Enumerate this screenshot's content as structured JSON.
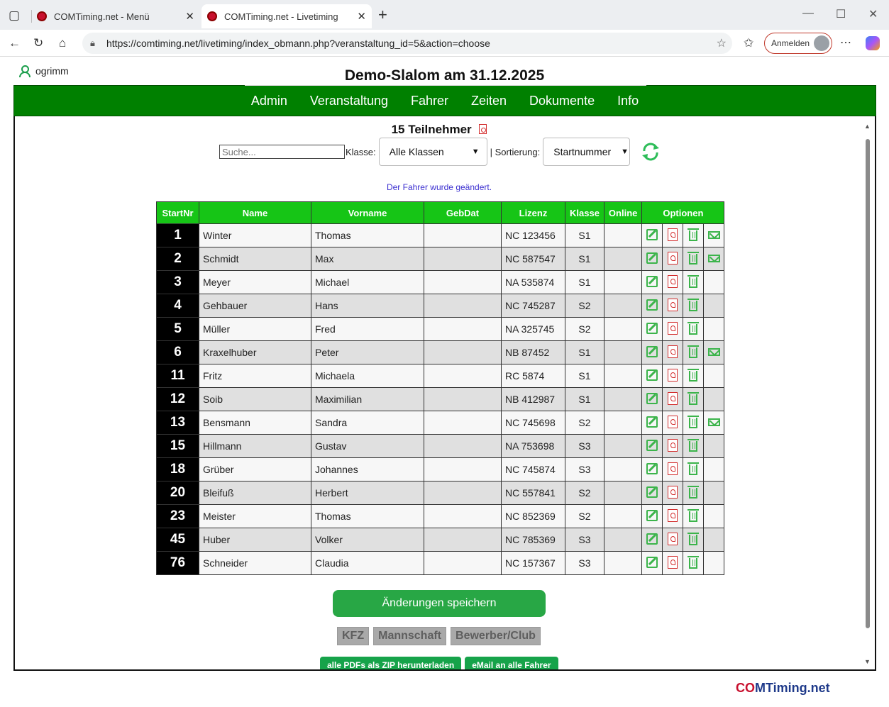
{
  "browser": {
    "tab1_title": "COMTiming.net - Menü",
    "tab2_title": "COMTiming.net - Livetiming",
    "url": "https://comtiming.net/livetiming/index_obmann.php?veranstaltung_id=5&action=choose",
    "signin_label": "Anmelden"
  },
  "user": {
    "name": "ogrimm"
  },
  "event": {
    "title": "Demo-Slalom am 31.12.2025"
  },
  "nav": {
    "items": [
      "Admin",
      "Veranstaltung",
      "Fahrer",
      "Zeiten",
      "Dokumente",
      "Info"
    ]
  },
  "participants": {
    "count_label": "15 Teilnehmer"
  },
  "filters": {
    "search_placeholder": "Suche...",
    "class_label": "Klasse:",
    "class_value": "Alle Klassen",
    "sort_label": "| Sortierung:",
    "sort_value": "Startnummer"
  },
  "message": "Der Fahrer wurde geändert.",
  "table": {
    "headers": [
      "StartNr",
      "Name",
      "Vorname",
      "GebDat",
      "Lizenz",
      "Klasse",
      "Online",
      "Optionen"
    ],
    "rows": [
      {
        "nr": "1",
        "name": "Winter",
        "vorname": "Thomas",
        "gebdat": "",
        "lizenz": "NC 123456",
        "klasse": "S1",
        "online": "",
        "mail": true
      },
      {
        "nr": "2",
        "name": "Schmidt",
        "vorname": "Max",
        "gebdat": "",
        "lizenz": "NC 587547",
        "klasse": "S1",
        "online": "",
        "mail": true
      },
      {
        "nr": "3",
        "name": "Meyer",
        "vorname": "Michael",
        "gebdat": "",
        "lizenz": "NA 535874",
        "klasse": "S1",
        "online": "",
        "mail": false
      },
      {
        "nr": "4",
        "name": "Gehbauer",
        "vorname": "Hans",
        "gebdat": "",
        "lizenz": "NC 745287",
        "klasse": "S2",
        "online": "",
        "mail": false
      },
      {
        "nr": "5",
        "name": "Müller",
        "vorname": "Fred",
        "gebdat": "",
        "lizenz": "NA 325745",
        "klasse": "S2",
        "online": "",
        "mail": false
      },
      {
        "nr": "6",
        "name": "Kraxelhuber",
        "vorname": "Peter",
        "gebdat": "",
        "lizenz": "NB 87452",
        "klasse": "S1",
        "online": "",
        "mail": true
      },
      {
        "nr": "11",
        "name": "Fritz",
        "vorname": "Michaela",
        "gebdat": "",
        "lizenz": "RC 5874",
        "klasse": "S1",
        "online": "",
        "mail": false
      },
      {
        "nr": "12",
        "name": "Soib",
        "vorname": "Maximilian",
        "gebdat": "",
        "lizenz": "NB 412987",
        "klasse": "S1",
        "online": "",
        "mail": false
      },
      {
        "nr": "13",
        "name": "Bensmann",
        "vorname": "Sandra",
        "gebdat": "",
        "lizenz": "NC 745698",
        "klasse": "S2",
        "online": "",
        "mail": true
      },
      {
        "nr": "15",
        "name": "Hillmann",
        "vorname": "Gustav",
        "gebdat": "",
        "lizenz": "NA 753698",
        "klasse": "S3",
        "online": "",
        "mail": false
      },
      {
        "nr": "18",
        "name": "Grüber",
        "vorname": "Johannes",
        "gebdat": "",
        "lizenz": "NC 745874",
        "klasse": "S3",
        "online": "",
        "mail": false
      },
      {
        "nr": "20",
        "name": "Bleifuß",
        "vorname": "Herbert",
        "gebdat": "",
        "lizenz": "NC 557841",
        "klasse": "S2",
        "online": "",
        "mail": false
      },
      {
        "nr": "23",
        "name": "Meister",
        "vorname": "Thomas",
        "gebdat": "",
        "lizenz": "NC 852369",
        "klasse": "S2",
        "online": "",
        "mail": false
      },
      {
        "nr": "45",
        "name": "Huber",
        "vorname": "Volker",
        "gebdat": "",
        "lizenz": "NC 785369",
        "klasse": "S3",
        "online": "",
        "mail": false
      },
      {
        "nr": "76",
        "name": "Schneider",
        "vorname": "Claudia",
        "gebdat": "",
        "lizenz": "NC 157367",
        "klasse": "S3",
        "online": "",
        "mail": false
      }
    ]
  },
  "actions": {
    "save_label": "Änderungen speichern",
    "grey_buttons": [
      "KFZ",
      "Mannschaft",
      "Bewerber/Club"
    ],
    "zip_label": "alle PDFs als ZIP herunterladen",
    "mail_all_label": "eMail an alle Fahrer"
  },
  "logo": {
    "part1": "CO",
    "part2": "MTiming.net"
  },
  "colors": {
    "nav_green": "#008000",
    "header_green": "#16c516",
    "save_green": "#28a745"
  }
}
